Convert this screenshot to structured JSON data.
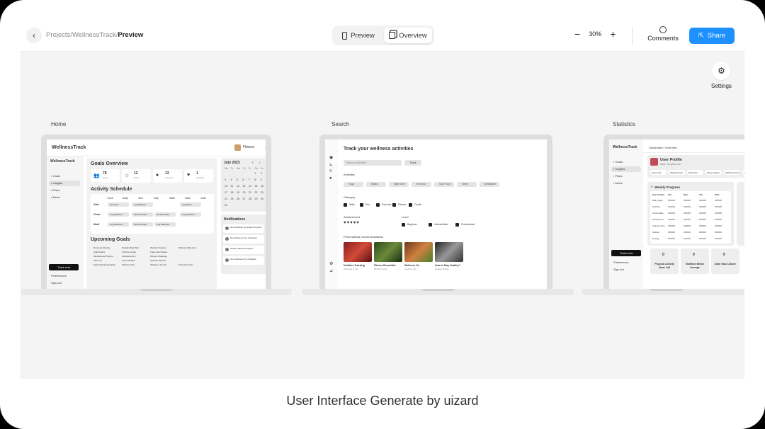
{
  "topbar": {
    "crumb_project": "Projects",
    "crumb_app": "WellnessTrack",
    "crumb_page": "Preview",
    "sep": "/",
    "preview_label": "Preview",
    "overview_label": "Overview",
    "zoom_minus": "−",
    "zoom_value": "30%",
    "zoom_plus": "+",
    "comments_label": "Comments",
    "share_label": "Share"
  },
  "canvas": {
    "settings_label": "Settings"
  },
  "screens": [
    {
      "label": "Home"
    },
    {
      "label": "Search"
    },
    {
      "label": "Statistics"
    }
  ],
  "home": {
    "brand": "WellnessTrack",
    "user": "Fitness",
    "nav": [
      "Goals",
      "Insights",
      "Plans",
      "Alerts"
    ],
    "goals_title": "Goals Overview",
    "stats": [
      {
        "value": "78",
        "sub": "points"
      },
      {
        "value": "12",
        "sub": "tasks"
      },
      {
        "value": "13",
        "sub": "progress"
      },
      {
        "value": "1",
        "sub": "activities"
      }
    ],
    "schedule_title": "Activity Schedule",
    "days": [
      "Track",
      "Andy",
      "Vlee",
      "Sdjs",
      "Want",
      "Mast",
      "Vedir"
    ],
    "rows": [
      {
        "name": "Gain",
        "cells": [
          "Set Goal",
          "Log Workout",
          "",
          "Log Mood"
        ]
      },
      {
        "name": "Chew",
        "cells": [
          "Log Wellness",
          "Set Reminder",
          "Set Reminder",
          "Log Wellness"
        ]
      },
      {
        "name": "Marti",
        "cells": [
          "Log Wellness",
          "Set Reminder",
          "Log Wellness",
          ""
        ]
      }
    ],
    "upcoming_title": "Upcoming Goals",
    "upcoming": [
      [
        "Recovery Routine",
        "High Bodies",
        "Mindfulness Practice",
        "Plan Trip",
        "Self-Healing Essentials"
      ],
      [
        "Weekly Meal Plan",
        "Nutrition Goals",
        "Achievement 1",
        "Personal Best",
        "Wellness Tag"
      ],
      [
        "Weekly Progress",
        "Track Heart Rates",
        "Fitness Challenge",
        "Workout Session",
        "Wellness Journal"
      ],
      [
        "Workout Schedule",
        "",
        "",
        "",
        "Personal Goals"
      ]
    ],
    "track_label": "Track now",
    "preferences": "Preferences",
    "sign_out": "Sign out",
    "calendar_title": "July 2023",
    "cal_days": [
      "Mo",
      "Tu",
      "We",
      "Th",
      "Fr",
      "Sa",
      "Su"
    ],
    "cal_nums": [
      "",
      "",
      "",
      "",
      "",
      "1",
      "2",
      "3",
      "4",
      "5",
      "6",
      "7",
      "8",
      "9",
      "10",
      "11",
      "12",
      "13",
      "14",
      "15",
      "16",
      "17",
      "18",
      "19",
      "20",
      "21",
      "22",
      "23",
      "24",
      "25",
      "26",
      "27",
      "28",
      "29",
      "30",
      "31"
    ],
    "notifications_title": "Notifications",
    "notifications": [
      "New Updates on Health Progress",
      "New Achievement Unlocked",
      "Weekly Wellness Digest",
      "New Wellness Tip Available"
    ]
  },
  "search": {
    "title": "Track your wellness activities",
    "placeholder": "Search activities",
    "search_btn": "Track",
    "section1": "Activities",
    "chips": [
      "Yoga",
      "Walks",
      "Night Diet",
      "Exercise",
      "Sole Food",
      "Sleep",
      "Meditation"
    ],
    "section2": "Category",
    "checks": [
      "Walk",
      "Run",
      "Exercise",
      "Fitness",
      "Cardio"
    ],
    "section3": "Achievement",
    "section4": "Level",
    "levels": [
      "Beginner",
      "Intermediate",
      "Professional"
    ],
    "section5": "Personalized recommendations",
    "cards": [
      {
        "title": "Nutrition Tracking",
        "sub": "Wellness & Life"
      },
      {
        "title": "Fitness Essentials",
        "sub": "Mindful Living"
      },
      {
        "title": "Wellness Go",
        "sub": "Health Food"
      },
      {
        "title": "How to Stay Healthy?",
        "sub": "Healthy Habits"
      }
    ]
  },
  "stats": {
    "brand": "WellnessTrack",
    "crumb": "Dashboard / Overview",
    "nav": [
      "Goals",
      "Insights",
      "Plans",
      "Alerts"
    ],
    "profile_name": "User Profile",
    "profile_sub": "Male, 26 years old",
    "tags": [
      "Active Set",
      "Weight Goals",
      "Workouts",
      "Sleep Quality",
      "Wellness Score",
      "Daily Steps"
    ],
    "weekly_title": "Weekly Progress",
    "cols": [
      "Key Activity",
      "Sat",
      "Mon",
      "Tue",
      "Wed"
    ],
    "rows": [
      "Daily steps",
      "Nutrition",
      "Fluid Intake",
      "Activity time",
      "Calories burn",
      "Sodium",
      "Energy"
    ],
    "cards": [
      {
        "value": "0",
        "title": "Physical Activity Ideal: 4x8"
      },
      {
        "value": "0",
        "title": "Nutrition Below Average"
      },
      {
        "value": "0",
        "title": "Daily Value Above"
      }
    ],
    "track_label": "Track now",
    "preferences": "Preferences",
    "sign_out": "Sign out"
  },
  "caption": "User Interface Generate by uizard"
}
